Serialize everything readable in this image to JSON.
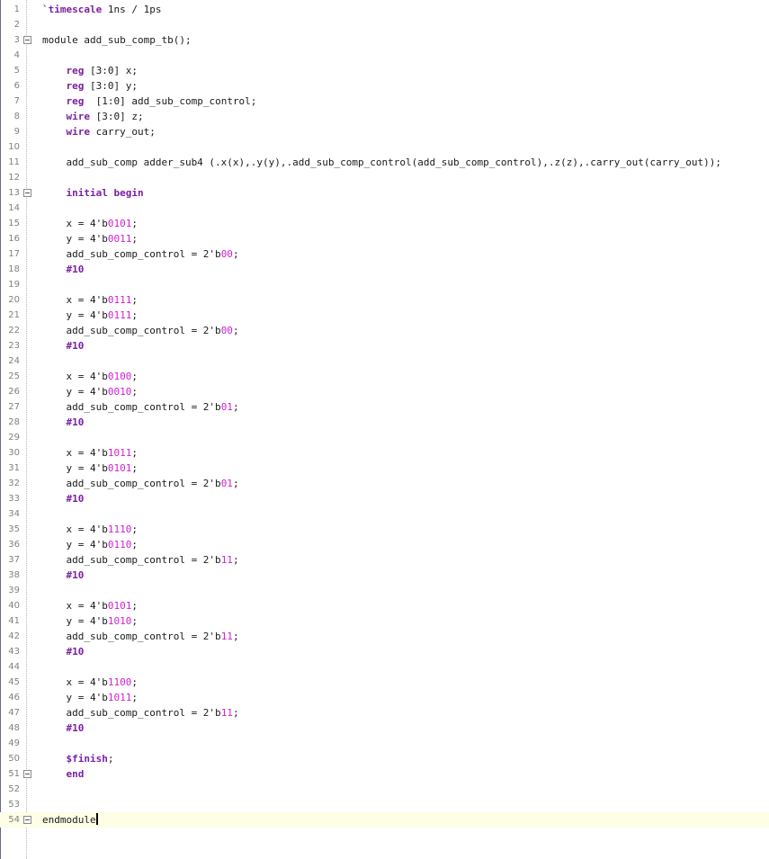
{
  "editor": {
    "language": "verilog",
    "colors": {
      "keyword": "#7b1fa2",
      "number": "#d11fd1",
      "text": "#1a1a1a",
      "line_number": "#808080",
      "current_line_bg": "#fefde6"
    },
    "current_line": 54,
    "lines": [
      {
        "n": "1",
        "tokens": [
          {
            "t": "kw",
            "v": "`timescale"
          },
          {
            "t": "plain",
            "v": " 1ns / 1ps"
          }
        ]
      },
      {
        "n": "2",
        "tokens": []
      },
      {
        "n": "3",
        "fold": true,
        "tokens": [
          {
            "t": "plain",
            "v": "module add_sub_comp_tb();"
          }
        ]
      },
      {
        "n": "4",
        "tokens": []
      },
      {
        "n": "5",
        "tokens": [
          {
            "t": "plain",
            "v": "    "
          },
          {
            "t": "kw",
            "v": "reg"
          },
          {
            "t": "plain",
            "v": " [3:0] x;"
          }
        ]
      },
      {
        "n": "6",
        "tokens": [
          {
            "t": "plain",
            "v": "    "
          },
          {
            "t": "kw",
            "v": "reg"
          },
          {
            "t": "plain",
            "v": " [3:0] y;"
          }
        ]
      },
      {
        "n": "7",
        "tokens": [
          {
            "t": "plain",
            "v": "    "
          },
          {
            "t": "kw",
            "v": "reg"
          },
          {
            "t": "plain",
            "v": "  [1:0] add_sub_comp_control;"
          }
        ]
      },
      {
        "n": "8",
        "tokens": [
          {
            "t": "plain",
            "v": "    "
          },
          {
            "t": "kw",
            "v": "wire"
          },
          {
            "t": "plain",
            "v": " [3:0] z;"
          }
        ]
      },
      {
        "n": "9",
        "tokens": [
          {
            "t": "plain",
            "v": "    "
          },
          {
            "t": "kw",
            "v": "wire"
          },
          {
            "t": "plain",
            "v": " carry_out;"
          }
        ]
      },
      {
        "n": "10",
        "tokens": []
      },
      {
        "n": "11",
        "tokens": [
          {
            "t": "plain",
            "v": "    add_sub_comp adder_sub4 (.x(x),.y(y),.add_sub_comp_control(add_sub_comp_control),.z(z),.carry_out(carry_out));"
          }
        ]
      },
      {
        "n": "12",
        "tokens": []
      },
      {
        "n": "13",
        "fold": true,
        "tokens": [
          {
            "t": "plain",
            "v": "    "
          },
          {
            "t": "kw",
            "v": "initial begin"
          }
        ]
      },
      {
        "n": "14",
        "tokens": []
      },
      {
        "n": "15",
        "tokens": [
          {
            "t": "plain",
            "v": "    x = 4'b"
          },
          {
            "t": "num",
            "v": "0101"
          },
          {
            "t": "plain",
            "v": ";"
          }
        ]
      },
      {
        "n": "16",
        "tokens": [
          {
            "t": "plain",
            "v": "    y = 4'b"
          },
          {
            "t": "num",
            "v": "0011"
          },
          {
            "t": "plain",
            "v": ";"
          }
        ]
      },
      {
        "n": "17",
        "tokens": [
          {
            "t": "plain",
            "v": "    add_sub_comp_control = 2'b"
          },
          {
            "t": "num",
            "v": "00"
          },
          {
            "t": "plain",
            "v": ";"
          }
        ]
      },
      {
        "n": "18",
        "tokens": [
          {
            "t": "plain",
            "v": "    "
          },
          {
            "t": "kw",
            "v": "#10"
          }
        ]
      },
      {
        "n": "19",
        "tokens": []
      },
      {
        "n": "20",
        "tokens": [
          {
            "t": "plain",
            "v": "    x = 4'b"
          },
          {
            "t": "num",
            "v": "0111"
          },
          {
            "t": "plain",
            "v": ";"
          }
        ]
      },
      {
        "n": "21",
        "tokens": [
          {
            "t": "plain",
            "v": "    y = 4'b"
          },
          {
            "t": "num",
            "v": "0111"
          },
          {
            "t": "plain",
            "v": ";"
          }
        ]
      },
      {
        "n": "22",
        "tokens": [
          {
            "t": "plain",
            "v": "    add_sub_comp_control = 2'b"
          },
          {
            "t": "num",
            "v": "00"
          },
          {
            "t": "plain",
            "v": ";"
          }
        ]
      },
      {
        "n": "23",
        "tokens": [
          {
            "t": "plain",
            "v": "    "
          },
          {
            "t": "kw",
            "v": "#10"
          }
        ]
      },
      {
        "n": "24",
        "tokens": []
      },
      {
        "n": "25",
        "tokens": [
          {
            "t": "plain",
            "v": "    x = 4'b"
          },
          {
            "t": "num",
            "v": "0100"
          },
          {
            "t": "plain",
            "v": ";"
          }
        ]
      },
      {
        "n": "26",
        "tokens": [
          {
            "t": "plain",
            "v": "    y = 4'b"
          },
          {
            "t": "num",
            "v": "0010"
          },
          {
            "t": "plain",
            "v": ";"
          }
        ]
      },
      {
        "n": "27",
        "tokens": [
          {
            "t": "plain",
            "v": "    add_sub_comp_control = 2'b"
          },
          {
            "t": "num",
            "v": "01"
          },
          {
            "t": "plain",
            "v": ";"
          }
        ]
      },
      {
        "n": "28",
        "tokens": [
          {
            "t": "plain",
            "v": "    "
          },
          {
            "t": "kw",
            "v": "#10"
          }
        ]
      },
      {
        "n": "29",
        "tokens": []
      },
      {
        "n": "30",
        "tokens": [
          {
            "t": "plain",
            "v": "    x = 4'b"
          },
          {
            "t": "num",
            "v": "1011"
          },
          {
            "t": "plain",
            "v": ";"
          }
        ]
      },
      {
        "n": "31",
        "tokens": [
          {
            "t": "plain",
            "v": "    y = 4'b"
          },
          {
            "t": "num",
            "v": "0101"
          },
          {
            "t": "plain",
            "v": ";"
          }
        ]
      },
      {
        "n": "32",
        "tokens": [
          {
            "t": "plain",
            "v": "    add_sub_comp_control = 2'b"
          },
          {
            "t": "num",
            "v": "01"
          },
          {
            "t": "plain",
            "v": ";"
          }
        ]
      },
      {
        "n": "33",
        "tokens": [
          {
            "t": "plain",
            "v": "    "
          },
          {
            "t": "kw",
            "v": "#10"
          }
        ]
      },
      {
        "n": "34",
        "tokens": []
      },
      {
        "n": "35",
        "tokens": [
          {
            "t": "plain",
            "v": "    x = 4'b"
          },
          {
            "t": "num",
            "v": "1110"
          },
          {
            "t": "plain",
            "v": ";"
          }
        ]
      },
      {
        "n": "36",
        "tokens": [
          {
            "t": "plain",
            "v": "    y = 4'b"
          },
          {
            "t": "num",
            "v": "0110"
          },
          {
            "t": "plain",
            "v": ";"
          }
        ]
      },
      {
        "n": "37",
        "tokens": [
          {
            "t": "plain",
            "v": "    add_sub_comp_control = 2'b"
          },
          {
            "t": "num",
            "v": "11"
          },
          {
            "t": "plain",
            "v": ";"
          }
        ]
      },
      {
        "n": "38",
        "tokens": [
          {
            "t": "plain",
            "v": "    "
          },
          {
            "t": "kw",
            "v": "#10"
          }
        ]
      },
      {
        "n": "39",
        "tokens": []
      },
      {
        "n": "40",
        "tokens": [
          {
            "t": "plain",
            "v": "    x = 4'b"
          },
          {
            "t": "num",
            "v": "0101"
          },
          {
            "t": "plain",
            "v": ";"
          }
        ]
      },
      {
        "n": "41",
        "tokens": [
          {
            "t": "plain",
            "v": "    y = 4'b"
          },
          {
            "t": "num",
            "v": "1010"
          },
          {
            "t": "plain",
            "v": ";"
          }
        ]
      },
      {
        "n": "42",
        "tokens": [
          {
            "t": "plain",
            "v": "    add_sub_comp_control = 2'b"
          },
          {
            "t": "num",
            "v": "11"
          },
          {
            "t": "plain",
            "v": ";"
          }
        ]
      },
      {
        "n": "43",
        "tokens": [
          {
            "t": "plain",
            "v": "    "
          },
          {
            "t": "kw",
            "v": "#10"
          }
        ]
      },
      {
        "n": "44",
        "tokens": []
      },
      {
        "n": "45",
        "tokens": [
          {
            "t": "plain",
            "v": "    x = 4'b"
          },
          {
            "t": "num",
            "v": "1100"
          },
          {
            "t": "plain",
            "v": ";"
          }
        ]
      },
      {
        "n": "46",
        "tokens": [
          {
            "t": "plain",
            "v": "    y = 4'b"
          },
          {
            "t": "num",
            "v": "1011"
          },
          {
            "t": "plain",
            "v": ";"
          }
        ]
      },
      {
        "n": "47",
        "tokens": [
          {
            "t": "plain",
            "v": "    add_sub_comp_control = 2'b"
          },
          {
            "t": "num",
            "v": "11"
          },
          {
            "t": "plain",
            "v": ";"
          }
        ]
      },
      {
        "n": "48",
        "tokens": [
          {
            "t": "plain",
            "v": "    "
          },
          {
            "t": "kw",
            "v": "#10"
          }
        ]
      },
      {
        "n": "49",
        "tokens": []
      },
      {
        "n": "50",
        "tokens": [
          {
            "t": "plain",
            "v": "    "
          },
          {
            "t": "kw",
            "v": "$finish"
          },
          {
            "t": "plain",
            "v": ";"
          }
        ]
      },
      {
        "n": "51",
        "fold": true,
        "tokens": [
          {
            "t": "plain",
            "v": "    "
          },
          {
            "t": "kw",
            "v": "end"
          }
        ]
      },
      {
        "n": "52",
        "tokens": []
      },
      {
        "n": "53",
        "tokens": []
      },
      {
        "n": "54",
        "fold": true,
        "current": true,
        "tokens": [
          {
            "t": "plain",
            "v": "endmodule"
          }
        ]
      }
    ]
  }
}
